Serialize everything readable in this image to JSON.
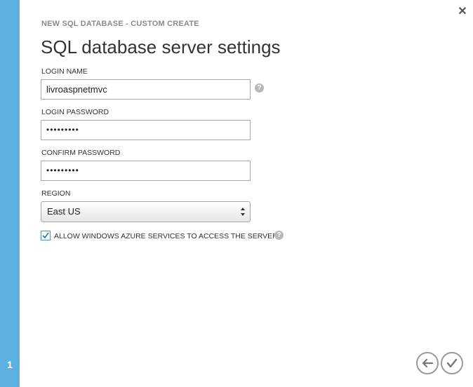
{
  "wizard": {
    "step": "1",
    "subtitle": "NEW SQL DATABASE - CUSTOM CREATE",
    "title": "SQL database server settings"
  },
  "form": {
    "login_name": {
      "label": "LOGIN NAME",
      "value": "livroaspnetmvc"
    },
    "login_password": {
      "label": "LOGIN PASSWORD",
      "value": "•••••••••"
    },
    "confirm_password": {
      "label": "CONFIRM PASSWORD",
      "value": "•••••••••"
    },
    "region": {
      "label": "REGION",
      "value": "East US"
    },
    "allow_azure": {
      "label": "ALLOW WINDOWS AZURE SERVICES TO ACCESS THE SERVER.",
      "checked": true
    }
  },
  "icons": {
    "close": "close-icon",
    "help": "help-icon",
    "back": "back-arrow-icon",
    "complete": "checkmark-icon"
  },
  "colors": {
    "rail": "#5cb1e0",
    "checkbox": "#4a90c8"
  }
}
